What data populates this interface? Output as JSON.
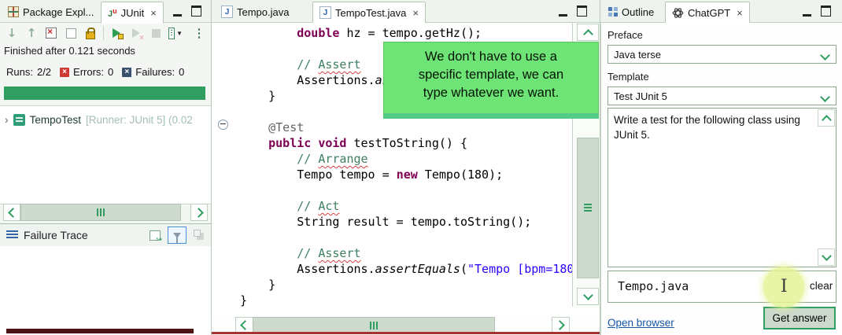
{
  "glyphs": {
    "close": "×",
    "dropdown_caret": "▼",
    "menu_dots": "⋮",
    "arrow_down": "↓",
    "arrow_up": "↑",
    "expander": "›"
  },
  "left_panel": {
    "tabs": [
      {
        "label": "Package Expl..."
      },
      {
        "label": "JUnit"
      }
    ],
    "status": "Finished after 0.121 seconds",
    "counts": {
      "runs_label": "Runs:",
      "runs": "2/2",
      "errors_label": "Errors:",
      "errors": "0",
      "failures_label": "Failures:",
      "failures": "0"
    },
    "tree": {
      "name": "TempoTest",
      "runner": " [Runner: JUnit 5] (0.02"
    },
    "failure_trace_title": "Failure Trace"
  },
  "editor": {
    "tabs": [
      {
        "label": "Tempo.java"
      },
      {
        "label": "TempoTest.java"
      }
    ],
    "code_lines": [
      [
        {
          "t": "        "
        },
        {
          "t": "double",
          "c": "kw"
        },
        {
          "t": " hz = tempo.getHz();"
        }
      ],
      [],
      [
        {
          "t": "        "
        },
        {
          "t": "// ",
          "c": "cm"
        },
        {
          "t": "Assert",
          "c": "cmw"
        }
      ],
      [
        {
          "t": "        "
        },
        {
          "t": "Assertions."
        },
        {
          "t": "as",
          "c": "itl"
        }
      ],
      [
        {
          "t": "    }"
        }
      ],
      [],
      [
        {
          "t": "    "
        },
        {
          "t": "@Test",
          "c": "ann"
        }
      ],
      [
        {
          "t": "    "
        },
        {
          "t": "public",
          "c": "kw"
        },
        {
          "t": " "
        },
        {
          "t": "void",
          "c": "kw"
        },
        {
          "t": " testToString() {"
        }
      ],
      [
        {
          "t": "        "
        },
        {
          "t": "// ",
          "c": "cm"
        },
        {
          "t": "Arrange",
          "c": "cmw"
        }
      ],
      [
        {
          "t": "        "
        },
        {
          "t": "Tempo tempo = "
        },
        {
          "t": "new",
          "c": "kw"
        },
        {
          "t": " Tempo(180);"
        }
      ],
      [],
      [
        {
          "t": "        "
        },
        {
          "t": "// ",
          "c": "cm"
        },
        {
          "t": "Act",
          "c": "cmw"
        }
      ],
      [
        {
          "t": "        "
        },
        {
          "t": "String result = tempo.toString();"
        }
      ],
      [],
      [
        {
          "t": "        "
        },
        {
          "t": "// ",
          "c": "cm"
        },
        {
          "t": "Assert",
          "c": "cmw"
        }
      ],
      [
        {
          "t": "        "
        },
        {
          "t": "Assertions."
        },
        {
          "t": "assertEquals",
          "c": "itl"
        },
        {
          "t": "("
        },
        {
          "t": "\"Tempo [bpm=180",
          "c": "str"
        }
      ],
      [
        {
          "t": "    }"
        }
      ],
      [
        {
          "t": "}"
        }
      ]
    ],
    "tooltip_lines": [
      "We don't have to use a",
      "specific template, we can",
      "type whatever we want."
    ]
  },
  "right_panel": {
    "tabs": [
      {
        "label": "Outline"
      },
      {
        "label": "ChatGPT"
      }
    ],
    "preface_label": "Preface",
    "preface_value": "Java terse",
    "template_label": "Template",
    "template_value": "Test JUnit 5",
    "prompt_text": "Write a test for the following class using JUnit 5.",
    "file_input_value": "Tempo.java",
    "clear_label": "clear",
    "open_browser_label": "Open browser",
    "get_answer_label": "Get answer"
  },
  "colors": {
    "accent_green": "#2f9e60",
    "tooltip_green": "#6fe476",
    "keyword": "#7f0055",
    "comment": "#3f7f5f",
    "string_literal": "#2a00ff",
    "annotation": "#646464",
    "link_blue": "#1556a8",
    "error_red": "#cc3a33"
  }
}
